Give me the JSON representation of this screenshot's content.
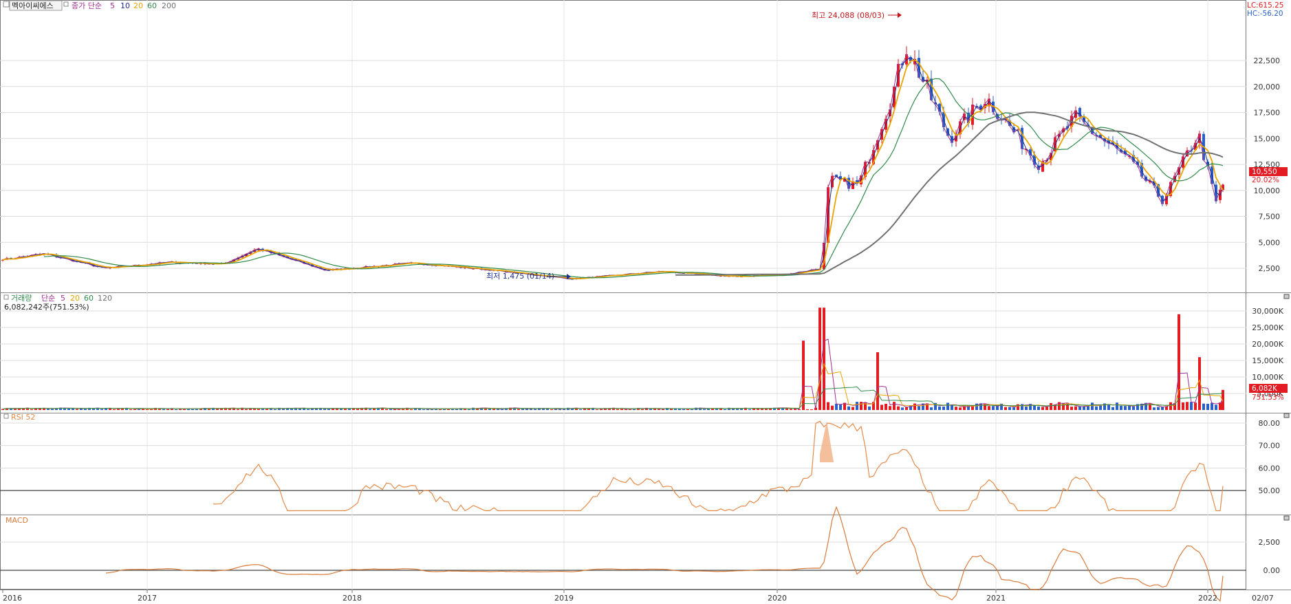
{
  "header": {
    "stock_name": "멕아이씨에스",
    "price_legend_label": "종가 단순",
    "price_ma_periods": [
      "5",
      "10",
      "20",
      "60",
      "200"
    ],
    "lc_label": "LC:615.25",
    "hc_label": "HC:-56.20"
  },
  "price_panel": {
    "y_ticks": [
      "22,500",
      "20,000",
      "17,500",
      "15,000",
      "12,500",
      "10,000",
      "7,500",
      "5,000",
      "2,500"
    ],
    "y_tick_values": [
      22500,
      20000,
      17500,
      15000,
      12500,
      10000,
      7500,
      5000,
      2500
    ],
    "max_label": "최고 24,088 (08/03)",
    "min_label": "최저 1,475 (01/14)",
    "current_price": "10,550",
    "current_change": "20.02%"
  },
  "volume_panel": {
    "legend_label": "거래량",
    "legend_method": "단순",
    "ma_periods": [
      "5",
      "20",
      "60",
      "120"
    ],
    "current_volume": "6,082,242주(751.53%)",
    "y_ticks": [
      "30,000K",
      "25,000K",
      "20,000K",
      "15,000K",
      "10,000K",
      "5,000K"
    ],
    "y_tick_values": [
      30000,
      25000,
      20000,
      15000,
      10000,
      5000
    ],
    "current_tag": "6,082K",
    "current_pct": "751.53%"
  },
  "rsi_panel": {
    "label": "RSI 52",
    "y_ticks": [
      "80.00",
      "70.00",
      "60.00",
      "50.00"
    ],
    "y_tick_values": [
      80,
      70,
      60,
      50
    ]
  },
  "macd_panel": {
    "label": "MACD",
    "y_ticks": [
      "2,500",
      "0.00"
    ],
    "y_tick_values": [
      2500,
      0
    ]
  },
  "x_axis": {
    "labels": [
      "2016",
      "2017",
      "2018",
      "2019",
      "2020",
      "2021",
      "2022"
    ],
    "end_label": "02/07"
  },
  "colors": {
    "up": "#e31b23",
    "down": "#2a5fc6",
    "ma5": "#a03090",
    "ma10": "#1e2a8a",
    "ma20": "#e8a300",
    "ma60": "#2f8a4a",
    "ma200": "#707070",
    "rsi": "#e38a4a",
    "macd": "#d87a3a"
  },
  "chart_data": {
    "type": "candlestick",
    "title": "멕아이씨에스",
    "x_range": [
      "2016-01",
      "2022-02-07"
    ],
    "price_ylim": [
      0,
      25000
    ],
    "price_anchors": [
      {
        "date": "2016-01",
        "close": 3400
      },
      {
        "date": "2016-04",
        "close": 3900
      },
      {
        "date": "2016-09",
        "close": 2500
      },
      {
        "date": "2017-02",
        "close": 3100
      },
      {
        "date": "2017-05",
        "close": 2900
      },
      {
        "date": "2017-07",
        "close": 4400
      },
      {
        "date": "2017-11",
        "close": 2300
      },
      {
        "date": "2018-04",
        "close": 3000
      },
      {
        "date": "2018-08",
        "close": 2400
      },
      {
        "date": "2019-01-14",
        "close": 1475
      },
      {
        "date": "2019-06",
        "close": 2200
      },
      {
        "date": "2019-10",
        "close": 1700
      },
      {
        "date": "2020-01",
        "close": 1900
      },
      {
        "date": "2020-03",
        "close": 2500
      },
      {
        "date": "2020-03",
        "close": 11000
      },
      {
        "date": "2020-05",
        "close": 10500
      },
      {
        "date": "2020-07",
        "close": 20000
      },
      {
        "date": "2020-08-03",
        "close": 24088
      },
      {
        "date": "2020-10",
        "close": 15000
      },
      {
        "date": "2020-12",
        "close": 19000
      },
      {
        "date": "2021-03",
        "close": 12500
      },
      {
        "date": "2021-05",
        "close": 17000
      },
      {
        "date": "2021-08",
        "close": 13000
      },
      {
        "date": "2021-10",
        "close": 9000
      },
      {
        "date": "2021-12",
        "close": 15500
      },
      {
        "date": "2022-01",
        "close": 8800
      },
      {
        "date": "2022-02-07",
        "close": 10550
      }
    ],
    "max": {
      "date": "08/03",
      "value": 24088
    },
    "min": {
      "date": "01/14",
      "value": 1475
    },
    "volume_ylim": [
      0,
      32000
    ],
    "volume_spikes_k": [
      {
        "date": "2020-02",
        "value": 21000
      },
      {
        "date": "2020-03",
        "value": 31000
      },
      {
        "date": "2020-06",
        "value": 17500
      },
      {
        "date": "2021-11",
        "value": 29000
      },
      {
        "date": "2021-12",
        "value": 16000
      },
      {
        "date": "2022-02-07",
        "value": 6082
      }
    ],
    "rsi_ylim": [
      38,
      83
    ],
    "rsi_last": 52,
    "macd_last": -500
  }
}
